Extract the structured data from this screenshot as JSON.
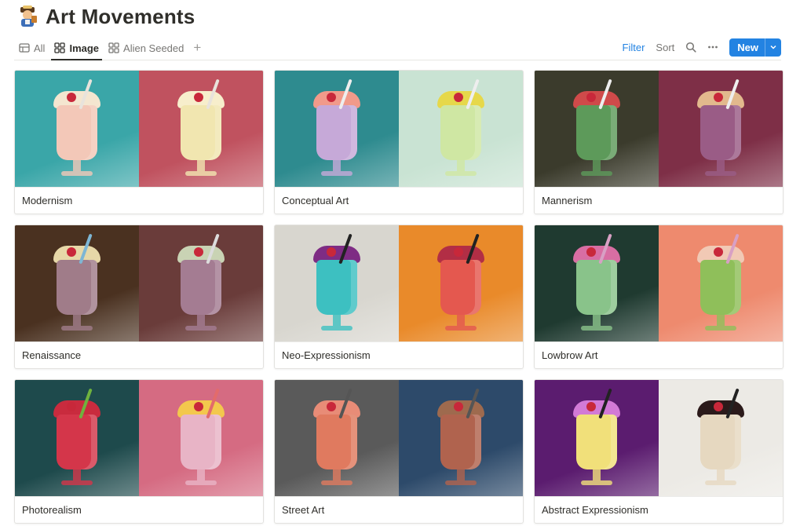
{
  "page": {
    "icon": "person-emoji-icon",
    "title": "Art Movements"
  },
  "views": [
    {
      "label": "All",
      "icon": "table-icon",
      "active": false
    },
    {
      "label": "Image",
      "icon": "gallery-icon",
      "active": true
    },
    {
      "label": "Alien Seeded",
      "icon": "gallery-icon",
      "active": false
    }
  ],
  "toolbar": {
    "add_view": "+",
    "filter": "Filter",
    "sort": "Sort",
    "new": "New"
  },
  "colors": {
    "accent": "#2383e2",
    "text": "#37352f",
    "muted": "#787774"
  },
  "cards": [
    {
      "title": "Modernism",
      "left": {
        "bg": "#3aa6a8",
        "drink": "#f3c8b8",
        "top": "#f4e6d0",
        "straw": "#e8e3dc"
      },
      "right": {
        "bg": "#c0525f",
        "drink": "#f1e6b0",
        "top": "#f7eecc",
        "straw": "#e8e3dc"
      }
    },
    {
      "title": "Conceptual Art",
      "left": {
        "bg": "#2e8b8f",
        "drink": "#c6a9d8",
        "top": "#f19a8a",
        "straw": "#eeeeee"
      },
      "right": {
        "bg": "#c9e3d3",
        "drink": "#cfe7a3",
        "top": "#e6d84a",
        "straw": "#eeeeee"
      }
    },
    {
      "title": "Mannerism",
      "left": {
        "bg": "#3b3b2c",
        "drink": "#5d9a5a",
        "top": "#cf4a4a",
        "straw": "#eeeeee"
      },
      "right": {
        "bg": "#7e2f47",
        "drink": "#9a5c86",
        "top": "#e2b98d",
        "straw": "#eeeeee"
      }
    },
    {
      "title": "Renaissance",
      "left": {
        "bg": "#4a3120",
        "drink": "#a07c89",
        "top": "#e7d8a8",
        "straw": "#7eb6d4"
      },
      "right": {
        "bg": "#6a3c3a",
        "drink": "#a47c92",
        "top": "#c9d3b4",
        "straw": "#dcdcdc"
      }
    },
    {
      "title": "Neo-Expressionism",
      "left": {
        "bg": "#d8d6cf",
        "drink": "#3dc0c1",
        "top": "#7e2c84",
        "straw": "#222222"
      },
      "right": {
        "bg": "#e98a2a",
        "drink": "#e4584f",
        "top": "#b22e45",
        "straw": "#222222"
      }
    },
    {
      "title": "Lowbrow Art",
      "left": {
        "bg": "#1f3a30",
        "drink": "#89c38a",
        "top": "#d86ea3",
        "straw": "#d8a0c4"
      },
      "right": {
        "bg": "#ee8a6e",
        "drink": "#8fbf5a",
        "top": "#f1c9b5",
        "straw": "#d8a0c4"
      }
    },
    {
      "title": "Photorealism",
      "left": {
        "bg": "#1e4a4c",
        "drink": "#d4364a",
        "top": "#c92b3e",
        "straw": "#6fb23e"
      },
      "right": {
        "bg": "#d56b82",
        "drink": "#e8b4c6",
        "top": "#f3c84d",
        "straw": "#e36b6b"
      }
    },
    {
      "title": "Street Art",
      "left": {
        "bg": "#5a5a5a",
        "drink": "#e07a5f",
        "top": "#e88c77",
        "straw": "#555555"
      },
      "right": {
        "bg": "#2d4a6a",
        "drink": "#b0634e",
        "top": "#9e6a4e",
        "straw": "#555555"
      }
    },
    {
      "title": "Abstract Expressionism",
      "left": {
        "bg": "#5b1c6f",
        "drink": "#f1e07a",
        "top": "#d27ad6",
        "straw": "#222222"
      },
      "right": {
        "bg": "#eceae5",
        "drink": "#e6d8c0",
        "top": "#2b1a1a",
        "straw": "#222222"
      }
    }
  ]
}
